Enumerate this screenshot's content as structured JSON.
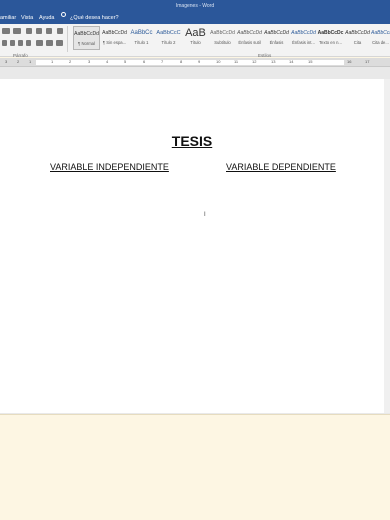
{
  "window": {
    "title": "Imagenes - Word"
  },
  "menu": {
    "items": [
      "amiliar",
      "Vista",
      "Ayuda"
    ],
    "tell_me": "¿Qué desea hacer?"
  },
  "ribbon": {
    "groups": [
      "Párrafo",
      "Estilos"
    ],
    "styles": [
      {
        "preview": "AaBbCcDd",
        "name": "¶ Normal"
      },
      {
        "preview": "AaBbCcDd",
        "name": "¶ Sin espa..."
      },
      {
        "preview": "AaBbCc",
        "name": "Título 1"
      },
      {
        "preview": "AaBbCcC",
        "name": "Título 2"
      },
      {
        "preview": "AaB",
        "name": "Título"
      },
      {
        "preview": "AaBbCcDd",
        "name": "Subtítulo"
      },
      {
        "preview": "AaBbCcDd",
        "name": "Énfasis sutil"
      },
      {
        "preview": "AaBbCcDd",
        "name": "Énfasis"
      },
      {
        "preview": "AaBbCcDd",
        "name": "Énfasis int..."
      },
      {
        "preview": "AaBbCcDc",
        "name": "Texto en n..."
      },
      {
        "preview": "AaBbCcDd",
        "name": "Cita"
      },
      {
        "preview": "AaBbCcDd",
        "name": "Cita de..."
      }
    ]
  },
  "ruler": {
    "numbers": [
      "3",
      "2",
      "1",
      "1",
      "2",
      "3",
      "4",
      "5",
      "6",
      "7",
      "8",
      "9",
      "10",
      "11",
      "12",
      "13",
      "14",
      "15",
      "16",
      "17"
    ]
  },
  "document": {
    "title": "TESIS",
    "independent_var": "VARIABLE INDEPENDIENTE",
    "dependent_var": "VARIABLE DEPENDIENTE",
    "cursor_mark": "I"
  }
}
